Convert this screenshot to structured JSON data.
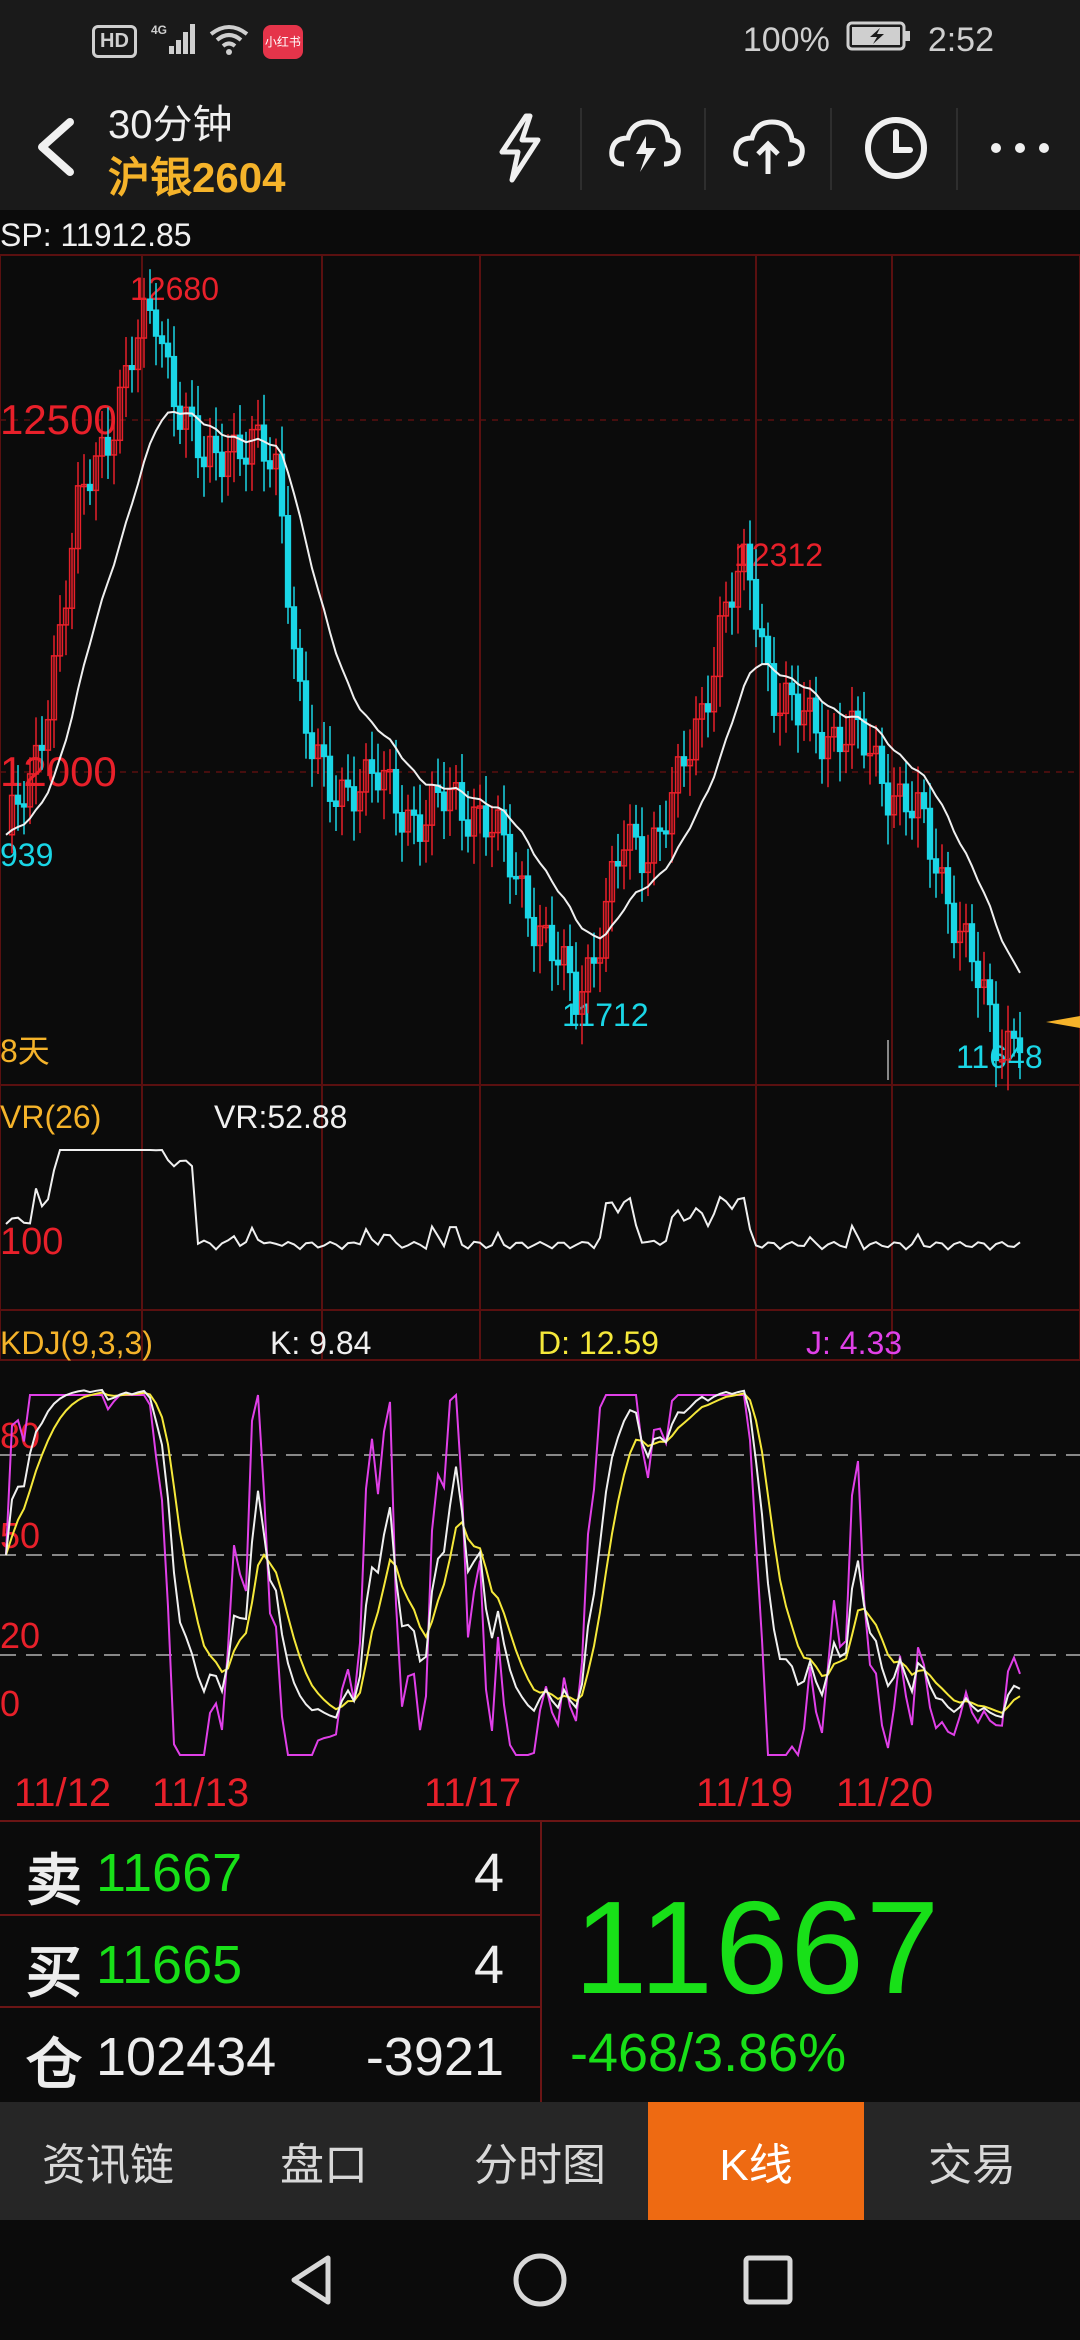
{
  "status": {
    "battery": "100%",
    "time": "2:52",
    "hd": "HD",
    "net": "4G",
    "app_badge": "小红书"
  },
  "header": {
    "period": "30分钟",
    "instrument": "沪银2604"
  },
  "main_chart": {
    "sp_label": "SP: 11912.85",
    "high_label": "12680",
    "price_12500": "12500",
    "price_12000": "12000",
    "left_cut_label": "939",
    "peak2_label": "12312",
    "low1_label": "11712",
    "low2_label": "11648",
    "days_label": "8天"
  },
  "vr": {
    "name": "VR(26)",
    "value": "VR:52.88",
    "level": "100"
  },
  "kdj": {
    "name": "KDJ(9,3,3)",
    "k": "K: 9.84",
    "d": "D: 12.59",
    "j": "J: 4.33",
    "levels": [
      "80",
      "50",
      "20",
      "0"
    ]
  },
  "dates": [
    "11/12",
    "11/13",
    "11/17",
    "11/19",
    "11/20"
  ],
  "quote": {
    "sell_label": "卖",
    "sell_price": "11667",
    "sell_qty": "4",
    "buy_label": "买",
    "buy_price": "11665",
    "buy_qty": "4",
    "oi_label": "仓",
    "oi_value": "102434",
    "oi_change": "-3921",
    "last_price": "11667",
    "change": "-468/3.86%"
  },
  "tabs": [
    "资讯链",
    "盘口",
    "分时图",
    "K线",
    "交易"
  ],
  "active_tab": "K线",
  "colors": {
    "up": "#e8202a",
    "down": "#1ad6e6",
    "gain": "#18e018",
    "accent": "#ee6a12",
    "gold": "#f5b32a"
  },
  "chart_data": {
    "type": "line",
    "title": "",
    "series": [
      {
        "name": "",
        "values": [
          11939,
          12000,
          12200,
          12400,
          12500,
          12600,
          12680,
          12550,
          12450,
          12500,
          12480,
          12450,
          12100,
          11990,
          12020,
          12010,
          11980,
          11960,
          11990,
          11980,
          11920,
          11860,
          11770,
          11712,
          11800,
          11920,
          11930,
          11980,
          12100,
          12250,
          12312,
          12150,
          12100,
          12090,
          12080,
          12050,
          12000,
          11950,
          11870,
          11760,
          11648,
          11667
        ]
      }
    ],
    "ylim": [
      11600,
      12750
    ],
    "xlabel": "",
    "ylabel": ""
  }
}
